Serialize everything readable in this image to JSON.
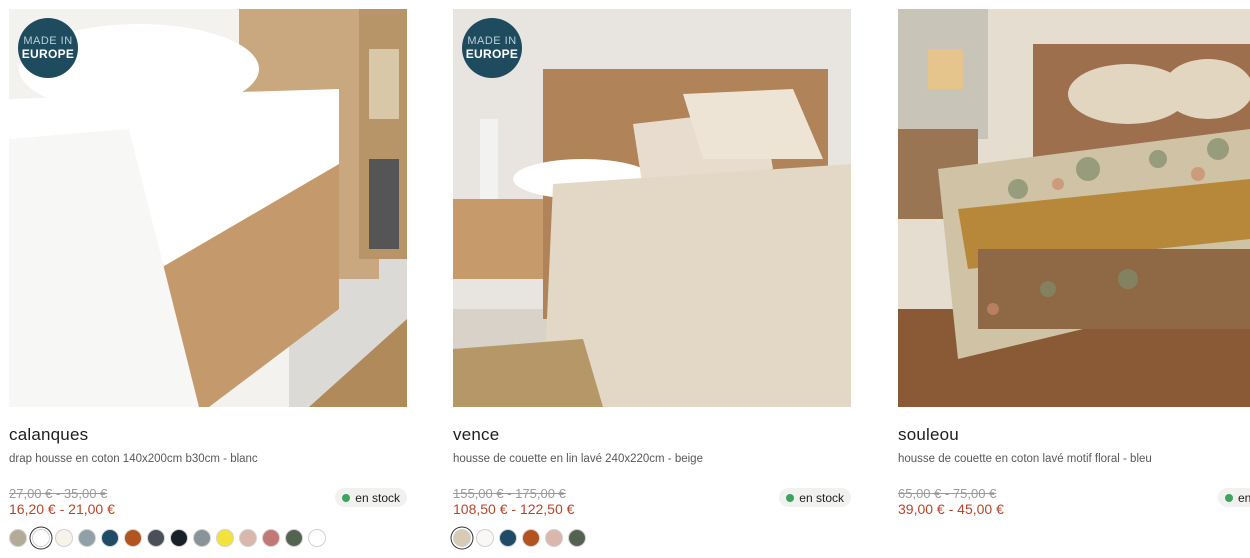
{
  "products": [
    {
      "badge": {
        "line1": "MADE IN",
        "line2": "EUROPE"
      },
      "name": "calanques",
      "description": "drap housse en coton 140x200cm b30cm - blanc",
      "old_price": "27,00 € - 35,00 €",
      "price": "16,20 € - 21,00 €",
      "stock": "en stock",
      "colors": [
        "#b3aa98",
        "#ffffff",
        "#f6f4e8",
        "#8fa0a6",
        "#1f4b66",
        "#b25320",
        "#4b5058",
        "#182028",
        "#8a9399",
        "#f3e23c",
        "#d9b7ad",
        "#c27975",
        "#546252",
        "#ffffff"
      ],
      "selected_color_index": 1
    },
    {
      "badge": {
        "line1": "MADE IN",
        "line2": "EUROPE"
      },
      "name": "vence",
      "description": "housse de couette en lin lavé 240x220cm - beige",
      "old_price": "155,00 € - 175,00 €",
      "price": "108,50 € - 122,50 €",
      "stock": "en stock",
      "colors": [
        "#d8cbb5",
        "#faf8f4",
        "#1f4b66",
        "#b25320",
        "#d9b7ad",
        "#546252"
      ],
      "selected_color_index": 0
    },
    {
      "name": "souleou",
      "description": "housse de couette en coton lavé motif floral - bleu",
      "old_price": "65,00 € - 75,00 €",
      "price": "39,00 € - 45,00 €",
      "stock": "en stock",
      "colors": [],
      "selected_color_index": -1
    }
  ]
}
